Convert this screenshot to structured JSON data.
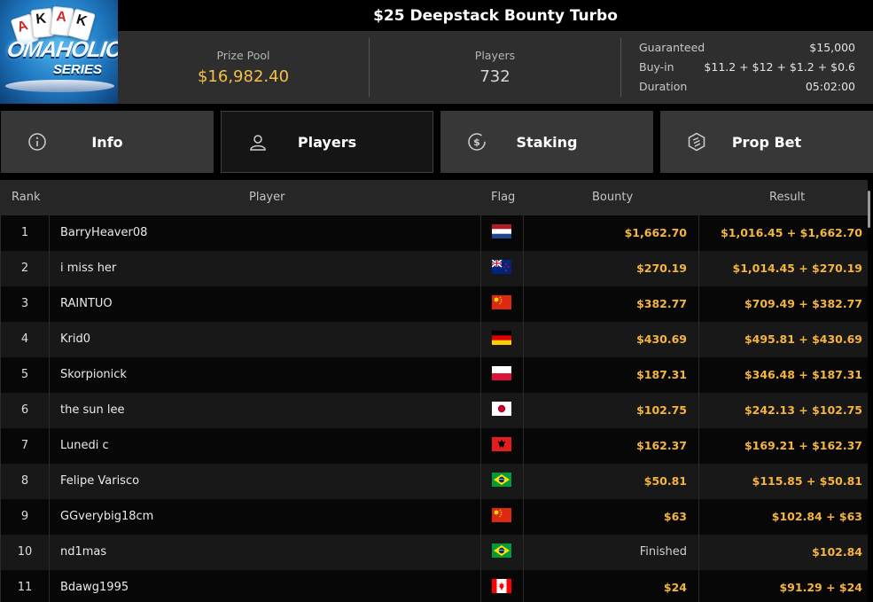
{
  "logo": {
    "cards": [
      "A",
      "K",
      "A",
      "K"
    ],
    "line1": "OMAHOLIC",
    "line2": "SERIES"
  },
  "tournament": {
    "title": "$25 Deepstack Bounty Turbo"
  },
  "stats": {
    "prize_pool_label": "Prize Pool",
    "prize_pool_value": "$16,982.40",
    "players_label": "Players",
    "players_value": "732",
    "guaranteed_label": "Guaranteed",
    "guaranteed_value": "$15,000",
    "buyin_label": "Buy-in",
    "buyin_value": "$11.2 + $12 + $1.2 + $0.6",
    "duration_label": "Duration",
    "duration_value": "05:02:00"
  },
  "tabs": [
    {
      "label": "Info",
      "icon": "info-icon",
      "active": false
    },
    {
      "label": "Players",
      "icon": "user-icon",
      "active": true
    },
    {
      "label": "Staking",
      "icon": "dollar-coin-icon",
      "active": false
    },
    {
      "label": "Prop Bet",
      "icon": "prop-bet-icon",
      "active": false
    }
  ],
  "table": {
    "headers": {
      "rank": "Rank",
      "player": "Player",
      "flag": "Flag",
      "bounty": "Bounty",
      "result": "Result"
    },
    "rows": [
      {
        "rank": "1",
        "player": "BarryHeaver08",
        "flag": "nl",
        "bounty": "$1,662.70",
        "result": "$1,016.45 + $1,662.70"
      },
      {
        "rank": "2",
        "player": "i miss her",
        "flag": "nz",
        "bounty": "$270.19",
        "result": "$1,014.45 + $270.19"
      },
      {
        "rank": "3",
        "player": "RAINTUO",
        "flag": "cn",
        "bounty": "$382.77",
        "result": "$709.49 + $382.77"
      },
      {
        "rank": "4",
        "player": "Krid0",
        "flag": "de",
        "bounty": "$430.69",
        "result": "$495.81 + $430.69"
      },
      {
        "rank": "5",
        "player": "Skorpionick",
        "flag": "pl",
        "bounty": "$187.31",
        "result": "$346.48 + $187.31"
      },
      {
        "rank": "6",
        "player": "the sun lee",
        "flag": "jp",
        "bounty": "$102.75",
        "result": "$242.13 + $102.75"
      },
      {
        "rank": "7",
        "player": "Lunedi c",
        "flag": "al",
        "bounty": "$162.37",
        "result": "$169.21 + $162.37"
      },
      {
        "rank": "8",
        "player": "Felipe Varisco",
        "flag": "br",
        "bounty": "$50.81",
        "result": "$115.85 + $50.81"
      },
      {
        "rank": "9",
        "player": "GGverybig18cm",
        "flag": "cn",
        "bounty": "$63",
        "result": "$102.84 + $63"
      },
      {
        "rank": "10",
        "player": "nd1mas",
        "flag": "br",
        "bounty": "Finished",
        "result": "$102.84"
      },
      {
        "rank": "11",
        "player": "Bdawg1995",
        "flag": "ca",
        "bounty": "$24",
        "result": "$91.29 + $24"
      }
    ]
  },
  "colors": {
    "accent": "#f5b53c",
    "prize": "#f5c04a",
    "panel": "#2e2e2e",
    "tab": "#373737"
  }
}
